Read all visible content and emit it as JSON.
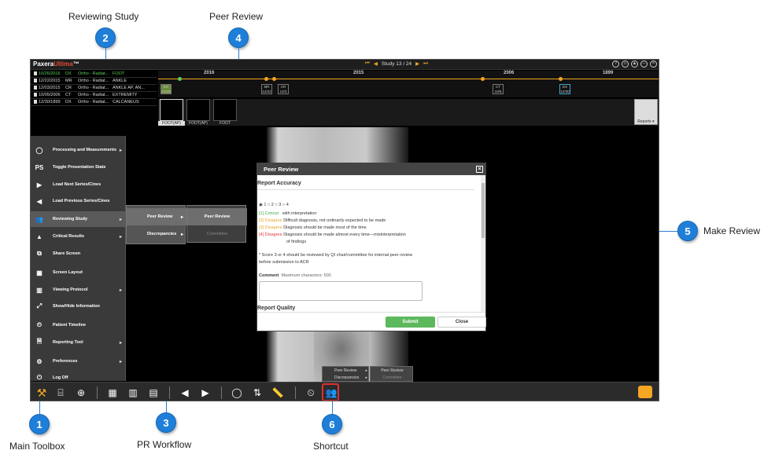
{
  "callouts": [
    {
      "num": "1",
      "label": "Main Toolbox"
    },
    {
      "num": "2",
      "label": "Reviewing Study"
    },
    {
      "num": "3",
      "label": "PR Workflow"
    },
    {
      "num": "4",
      "label": "Peer Review"
    },
    {
      "num": "5",
      "label": "Make Review"
    },
    {
      "num": "6",
      "label": "Shortcut"
    }
  ],
  "app": {
    "logo_prefix": "Paxera",
    "logo_suffix": "Ultima",
    "logo_tm": "™",
    "study_nav": "Study 13 / 24"
  },
  "study_list": [
    {
      "date": "10/26/2016",
      "mod": "DX",
      "desc": "Ortho - Radiat...",
      "part": "FOOT",
      "selected": true
    },
    {
      "date": "12/22/2015",
      "mod": "MR",
      "desc": "Ortho - Radiat...",
      "part": "ANKLE",
      "selected": false
    },
    {
      "date": "12/03/2015",
      "mod": "CR",
      "desc": "Ortho - Radiat...",
      "part": "ANKLE AP, AN...",
      "selected": false
    },
    {
      "date": "10/05/2006",
      "mod": "CT",
      "desc": "Ortho - Radiat...",
      "part": "EXTREMITY",
      "selected": false
    },
    {
      "date": "12/30/1899",
      "mod": "DX",
      "desc": "Ortho - Radiat...",
      "part": "CALCANEUS",
      "selected": false
    }
  ],
  "timeline": {
    "years": [
      "2016",
      "2015",
      "2006",
      "1899"
    ],
    "boxes": [
      {
        "mod": "DX",
        "date": "10/26"
      },
      {
        "mod": "MR",
        "date": "12/22"
      },
      {
        "mod": "CR",
        "date": "12/3"
      },
      {
        "mod": "CT",
        "date": "10/5"
      },
      {
        "mod": "DX",
        "date": "12/30"
      }
    ]
  },
  "thumbnails": [
    "FOOT(AP)",
    "FOOT(AP)",
    "FOOT"
  ],
  "reports_label": "Reports",
  "toolbox": {
    "items": [
      {
        "icon": "processing-icon",
        "glyph": "◯",
        "label": "Processing and Measurements",
        "arrow": true
      },
      {
        "icon": "ps-icon",
        "glyph": "PS",
        "label": "Toggle Presentation State",
        "arrow": false
      },
      {
        "icon": "next-icon",
        "glyph": "▶",
        "label": "Load Next Series/Cines",
        "arrow": false
      },
      {
        "icon": "previous-icon",
        "glyph": "◀",
        "label": "Load Previous Series/Cines",
        "arrow": false
      },
      {
        "icon": "reviewing-icon",
        "glyph": "👥",
        "label": "Reviewing Study",
        "arrow": true
      },
      {
        "icon": "warning-icon",
        "glyph": "▲",
        "label": "Critical Results",
        "arrow": true
      },
      {
        "icon": "share-icon",
        "glyph": "⧉",
        "label": "Share Screen",
        "arrow": false
      },
      {
        "icon": "layout-icon",
        "glyph": "▦",
        "label": "Screen Layout",
        "arrow": false
      },
      {
        "icon": "protocol-icon",
        "glyph": "▥",
        "label": "Viewing Protocol",
        "arrow": true
      },
      {
        "icon": "info-icon",
        "glyph": "⤢",
        "label": "Show/Hide Information",
        "arrow": false
      },
      {
        "icon": "timeline-icon",
        "glyph": "⏲",
        "label": "Patient Timeline",
        "arrow": false
      },
      {
        "icon": "report-icon",
        "glyph": "🗎",
        "label": "Reporting Tool",
        "arrow": true
      },
      {
        "icon": "gear-icon",
        "glyph": "⚙",
        "label": "Preferences",
        "arrow": true
      },
      {
        "icon": "power-icon",
        "glyph": "⏻",
        "label": "Log Off",
        "arrow": false
      }
    ]
  },
  "submenu1": [
    {
      "label": "Peer Review",
      "arrow": true
    },
    {
      "label": "Discrepancies",
      "arrow": true
    }
  ],
  "submenu2": [
    {
      "label": "Peer Review"
    },
    {
      "label": "Committee"
    }
  ],
  "dialog": {
    "title": "Peer Review",
    "accuracy_title": "Report Accuracy",
    "radio_options": [
      "1",
      "2",
      "3",
      "4"
    ],
    "scores": [
      {
        "code": "[1]",
        "tag": "Concur",
        "desc": "with interpretation"
      },
      {
        "code": "[2]",
        "tag": "Disagree",
        "desc": "Difficult diagnosis, not ordinarily expected to be made"
      },
      {
        "code": "[3]",
        "tag": "Disagree",
        "desc": "Diagnosis should be made most of the time"
      },
      {
        "code": "[4]",
        "tag": "Disagree",
        "desc": "Diagnosis should be made almost every time—misinterpretation"
      }
    ],
    "score4_cont": "of findings",
    "note_line1": "* Score 3 or 4 should be reviewed by QI chair/committee for internal peer review",
    "note_line2": "before submission to ACR",
    "comment_label": "Comment",
    "comment_hint": "Maximum characters: 500",
    "quality_title": "Report Quality",
    "submit": "Submit",
    "close": "Close"
  },
  "mini_menu": [
    {
      "label": "Peer Review"
    },
    {
      "label": "Discrepancies"
    }
  ],
  "mini_menu2": [
    {
      "label": "Peer Review"
    },
    {
      "label": "Committee"
    }
  ],
  "colors": {
    "callout": "#1f7fd8",
    "accent": "#f5a623",
    "submit": "#5cb85c",
    "highlight": "#e03030"
  }
}
